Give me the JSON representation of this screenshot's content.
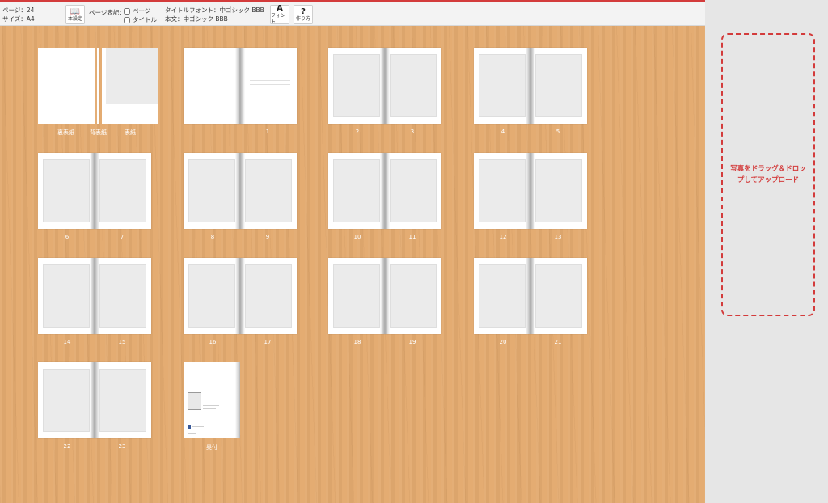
{
  "toolbar": {
    "page_count": "ページ：24",
    "size": "サイズ：A4",
    "book_settings": {
      "label": "本設定",
      "icon": "book-icon"
    },
    "page_notation_label": "ページ表記：",
    "check_page": "ページ",
    "check_title": "タイトル",
    "title_font": "タイトルフォント：中ゴシック BBB",
    "body_font": "本文：中ゴシック BBB",
    "font_button": {
      "label": "フォント",
      "icon": "A"
    },
    "howto_button": {
      "label": "作り方",
      "icon": "?"
    }
  },
  "cover": {
    "back_cover": "裏表紙",
    "inner_cover": "背表紙",
    "front_cover": "表紙"
  },
  "spreads": [
    {
      "left": "",
      "right": "1"
    },
    {
      "left": "2",
      "right": "3"
    },
    {
      "left": "4",
      "right": "5"
    },
    {
      "left": "6",
      "right": "7"
    },
    {
      "left": "8",
      "right": "9"
    },
    {
      "left": "10",
      "right": "11"
    },
    {
      "left": "12",
      "right": "13"
    },
    {
      "left": "14",
      "right": "15"
    },
    {
      "left": "16",
      "right": "17"
    },
    {
      "left": "18",
      "right": "19"
    },
    {
      "left": "20",
      "right": "21"
    },
    {
      "left": "22",
      "right": "23"
    }
  ],
  "colophon": {
    "label": "奥付"
  },
  "sidebar": {
    "dropzone_text": "写真をドラッグ＆ドロップしてアップロード"
  }
}
